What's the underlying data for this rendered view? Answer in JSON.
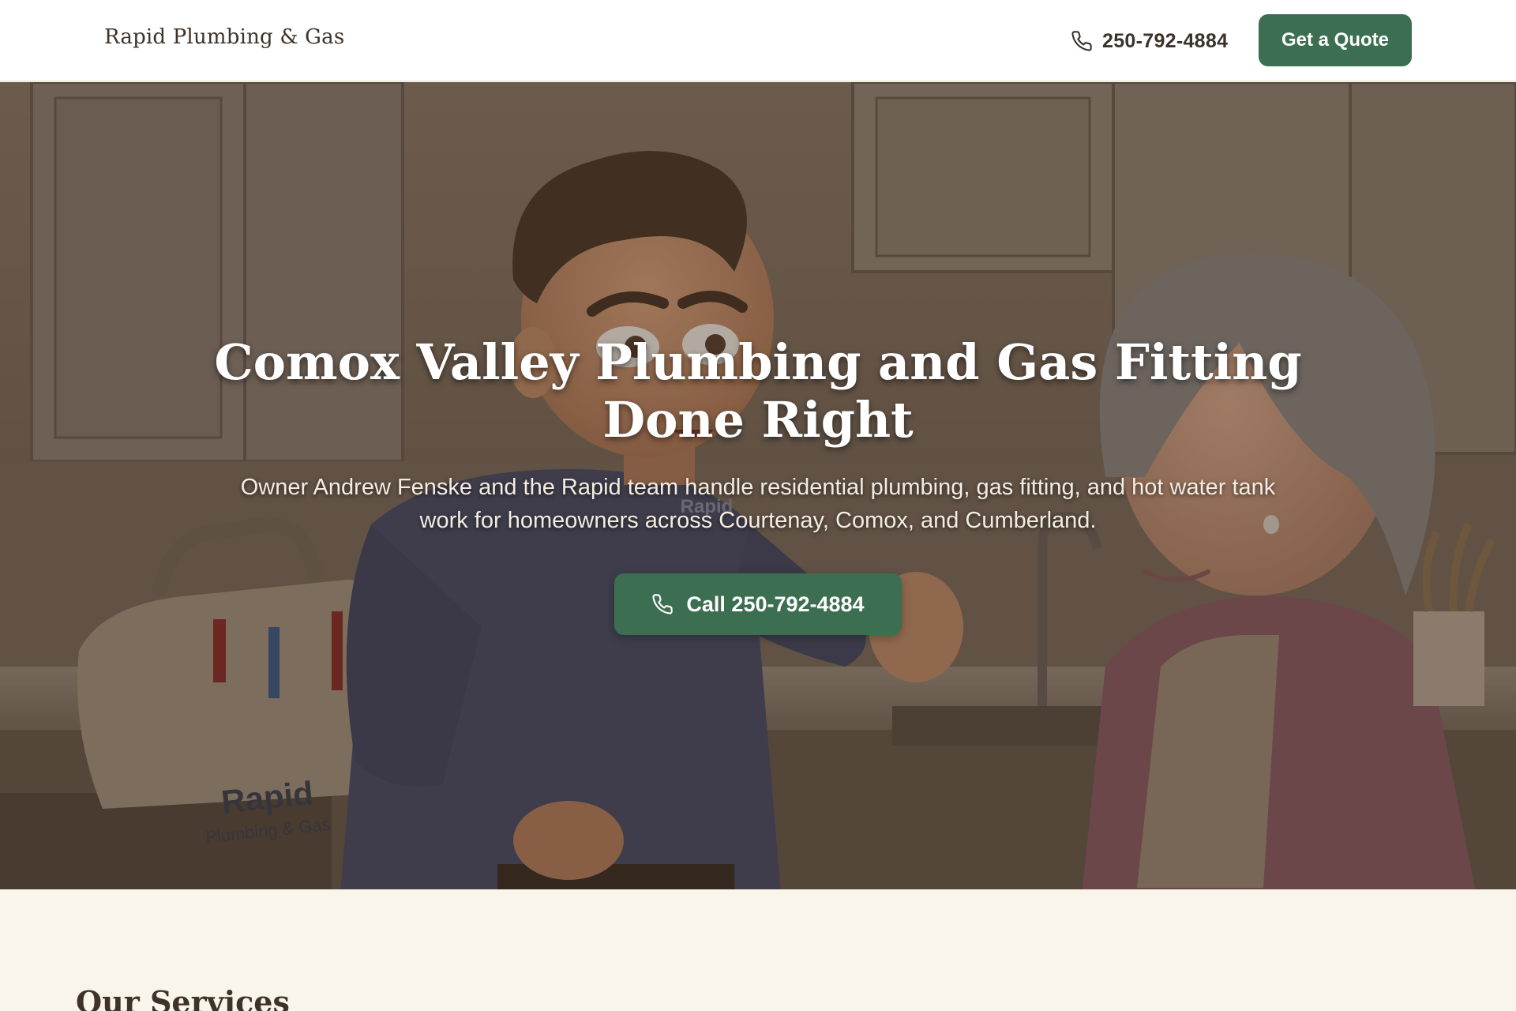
{
  "header": {
    "brand": "Rapid Plumbing & Gas",
    "phone": "250-792-4884",
    "phone_icon": "phone-icon",
    "quote_label": "Get a Quote",
    "accent_color": "#3c6f51"
  },
  "hero": {
    "title": "Comox Valley Plumbing and Gas Fitting Done Right",
    "subtitle": "Owner Andrew Fenske and the Rapid team handle residential plumbing, gas fitting, and hot water tank work for homeowners across Courtenay, Comox, and Cumberland.",
    "call_label": "Call 250-792-4884",
    "call_icon": "phone-icon",
    "bag_text_line1": "Rapid",
    "bag_text_line2": "Plumbing & Gas",
    "shirt_text": "Rapid"
  },
  "services": {
    "title": "Our Services"
  }
}
